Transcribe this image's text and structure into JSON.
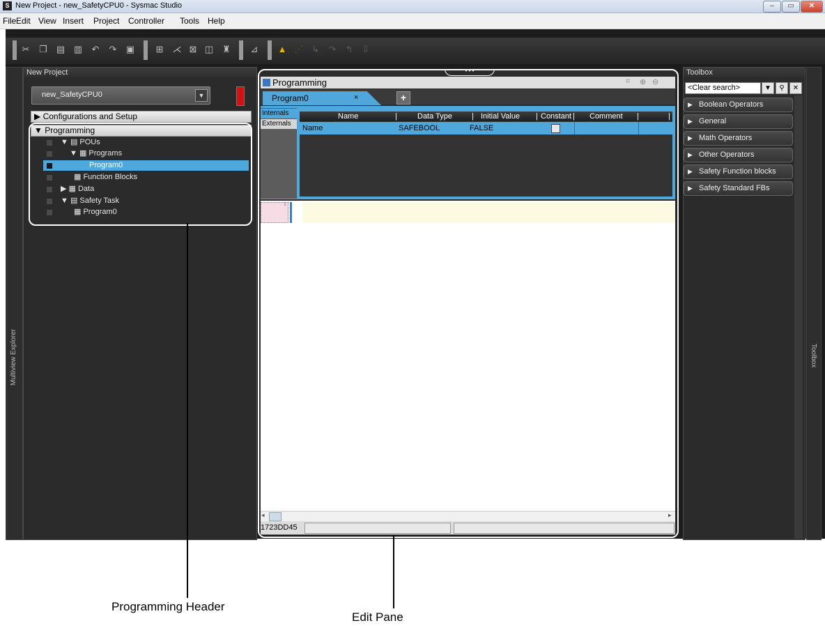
{
  "window": {
    "title": "New Project - new_SafetyCPU0 - Sysmac Studio",
    "app_icon": "S",
    "min": "–",
    "max": "▭",
    "close": "✕"
  },
  "menu": [
    "File",
    "Edit",
    "View",
    "Insert",
    "Project",
    "Controller",
    "Tools",
    "Help"
  ],
  "toolbar_icons": [
    "cut-icon",
    "copy-icon",
    "paste-icon",
    "delete-icon",
    "undo-icon",
    "redo-icon",
    "clipboard-icon",
    "structure-icon",
    "build-icon",
    "cross-reference-icon",
    "compare-icon",
    "find-icon",
    "online-icon",
    "warning-icon",
    "forced-refresh-icon",
    "step-icon",
    "step-over-icon",
    "step-out-icon",
    "download-icon"
  ],
  "multiview": {
    "strip_label": "Multiview Explorer",
    "header": "New Project",
    "device": "new_SafetyCPU0"
  },
  "tree": {
    "configurations": "▶ Configurations and Setup",
    "programming": "▼ Programming",
    "pous": "▼ ▤ POUs",
    "programs": "▼ ▦ Programs",
    "program0": "Program0",
    "function_blocks": "▦ Function Blocks",
    "data": "▶ ▦ Data",
    "safety_task": "▼ ▤ Safety Task",
    "task_program0": "▦ Program0"
  },
  "editor": {
    "title": "Programming",
    "tab": "Program0",
    "tab_close": "×",
    "add_tab": "+",
    "side_tabs": [
      "Internals",
      "Externals"
    ],
    "columns": [
      "Name",
      "Data Type",
      "Initial Value",
      "Constant",
      "Comment"
    ],
    "rows": [
      {
        "name": "Name",
        "data_type": "SAFEBOOL",
        "initial_value": "FALSE",
        "constant": false,
        "comment": ""
      }
    ],
    "rung_number": "1",
    "status_id": "1723DD45"
  },
  "toolbox": {
    "strip_label": "Toolbox",
    "header": "Toolbox",
    "search_placeholder": "<Clear search>",
    "items": [
      "Boolean Operators",
      "General",
      "Math Operators",
      "Other Operators",
      "Safety Function blocks",
      "Safety Standard FBs"
    ]
  },
  "callouts": {
    "programming_header": "Programming Header",
    "edit_pane": "Edit Pane"
  },
  "colors": {
    "selection": "#4ea8db",
    "app_background": "#1c1c1c",
    "indicator": "#d61010"
  }
}
